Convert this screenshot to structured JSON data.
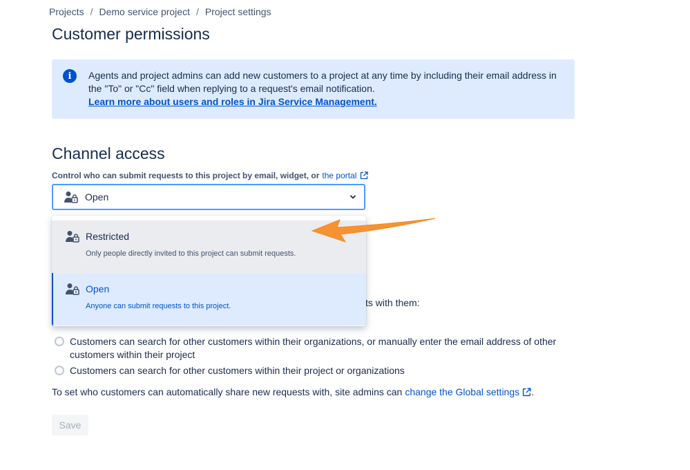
{
  "breadcrumb": [
    "Projects",
    "Demo service project",
    "Project settings"
  ],
  "page_title": "Customer permissions",
  "info": {
    "text": "Agents and project admins can add new customers to a project at any time by including their email address in the \"To\" or \"Cc\" field when replying to a request's email notification.",
    "link": "Learn more about users and roles in Jira Service Management."
  },
  "channel": {
    "title": "Channel access",
    "label": "Control who can submit requests to this project by email, widget, or",
    "label_link": "the portal",
    "selected": "Open",
    "options": [
      {
        "title": "Restricted",
        "desc": "Only people directly invited to this project can submit requests."
      },
      {
        "title": "Open",
        "desc": "Anyone can submit requests to this project."
      }
    ]
  },
  "sharing": {
    "hidden_tail": "sts with them:",
    "options": [
      "Customers can search for other customers within their organizations, or manually enter the email address of other customers within their project",
      "Customers can search for other customers within their project or organizations"
    ],
    "note": "To set who customers can automatically share new requests with, site admins can",
    "note_link": "change the Global settings",
    "note_end": "."
  },
  "save_label": "Save",
  "colors": {
    "accent": "#0052cc",
    "arrow": "#f79232",
    "info_bg": "#deebff"
  },
  "icons": [
    "info-icon",
    "user-lock-icon",
    "chevron-down-icon",
    "external-link-icon"
  ]
}
